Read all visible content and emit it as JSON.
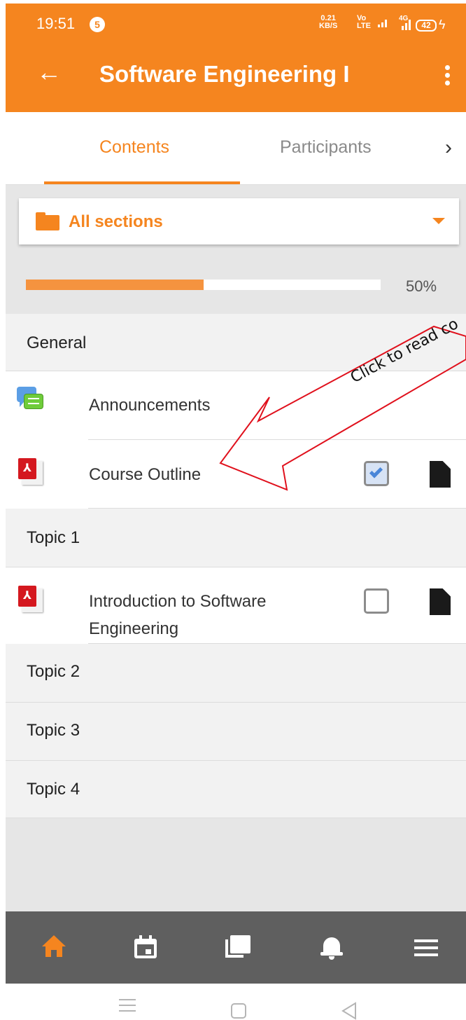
{
  "status_bar": {
    "time": "19:51",
    "notification_count": "5",
    "net_speed_value": "0.21",
    "net_speed_unit": "KB/S",
    "volte_top": "Vo",
    "volte_bottom": "LTE",
    "network_type": "4G",
    "battery": "42"
  },
  "app_bar": {
    "title": "Software Engineering I"
  },
  "tabs": {
    "contents": "Contents",
    "participants": "Participants"
  },
  "section_select": {
    "label": "All sections"
  },
  "progress": {
    "fraction": 0.5,
    "label": "50%"
  },
  "sections": [
    {
      "title": "General",
      "activities": [
        {
          "name": "Announcements",
          "icon": "forum-icon"
        },
        {
          "name": "Course Outline",
          "icon": "pdf-icon",
          "completed": true
        }
      ]
    },
    {
      "title": "Topic 1",
      "activities": [
        {
          "name_line1": "Introduction to Software",
          "name_line2": "Engineering",
          "icon": "pdf-icon",
          "completed": false
        }
      ]
    },
    {
      "title": "Topic 2"
    },
    {
      "title": "Topic 3"
    },
    {
      "title": "Topic 4"
    }
  ],
  "annotation": {
    "text": "Click to read co",
    "color": "#e0101c"
  },
  "colors": {
    "accent": "#f5851f",
    "nav_background": "#5f5f5f",
    "section_background": "#f2f2f2"
  },
  "bottom_nav": [
    "home-icon",
    "calendar-icon",
    "messages-icon",
    "notifications-icon",
    "menu-icon"
  ]
}
